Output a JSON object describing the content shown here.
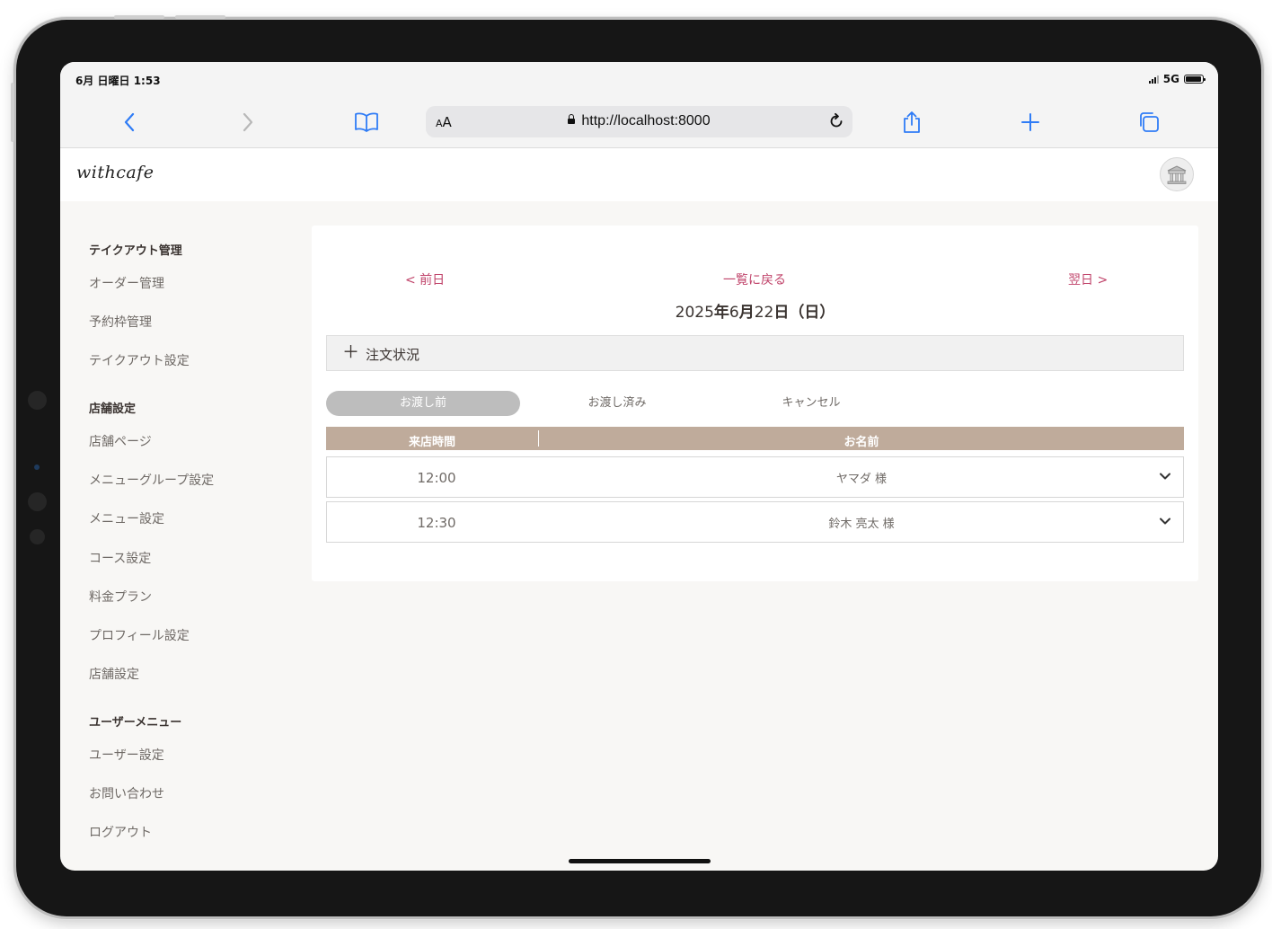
{
  "status": {
    "time": "6月 日曜日 1:53",
    "network": "5G"
  },
  "browser": {
    "aa_small": "A",
    "aa_large": "A",
    "url": "http://localhost:8000"
  },
  "app": {
    "logo": "withcafe"
  },
  "sidebar": {
    "sections": [
      {
        "heading": "テイクアウト管理",
        "items": [
          "オーダー管理",
          "予約枠管理",
          "テイクアウト設定"
        ]
      },
      {
        "heading": "店舗設定",
        "items": [
          "店舗ページ",
          "メニューグループ設定",
          "メニュー設定",
          "コース設定",
          "料金プラン",
          "プロフィール設定",
          "店舗設定"
        ]
      },
      {
        "heading": "ユーザーメニュー",
        "items": [
          "ユーザー設定",
          "お問い合わせ",
          "ログアウト"
        ]
      }
    ]
  },
  "main": {
    "prev_label": "< 前日",
    "back_label": "一覧に戻る",
    "next_label": "翌日 >",
    "date": {
      "year": "2025",
      "year_unit": "年",
      "month": "6",
      "month_unit": "月",
      "day": "22",
      "day_unit": "日",
      "weekday": "（日）"
    },
    "accordion_label": "注文状況",
    "tabs": [
      {
        "label": "お渡し前",
        "active": true
      },
      {
        "label": "お渡し済み",
        "active": false
      },
      {
        "label": "キャンセル",
        "active": false
      }
    ],
    "table": {
      "headers": [
        "来店時間",
        "お名前"
      ],
      "rows": [
        {
          "time": "12:00",
          "name": "ヤマダ 様"
        },
        {
          "time": "12:30",
          "name": "鈴木 亮太 様"
        }
      ]
    }
  },
  "colors": {
    "accent": "#c0436a",
    "table_header": "#bfab9b",
    "active_tab": "#bdbdbd",
    "ios_blue": "#2f7cf6"
  }
}
